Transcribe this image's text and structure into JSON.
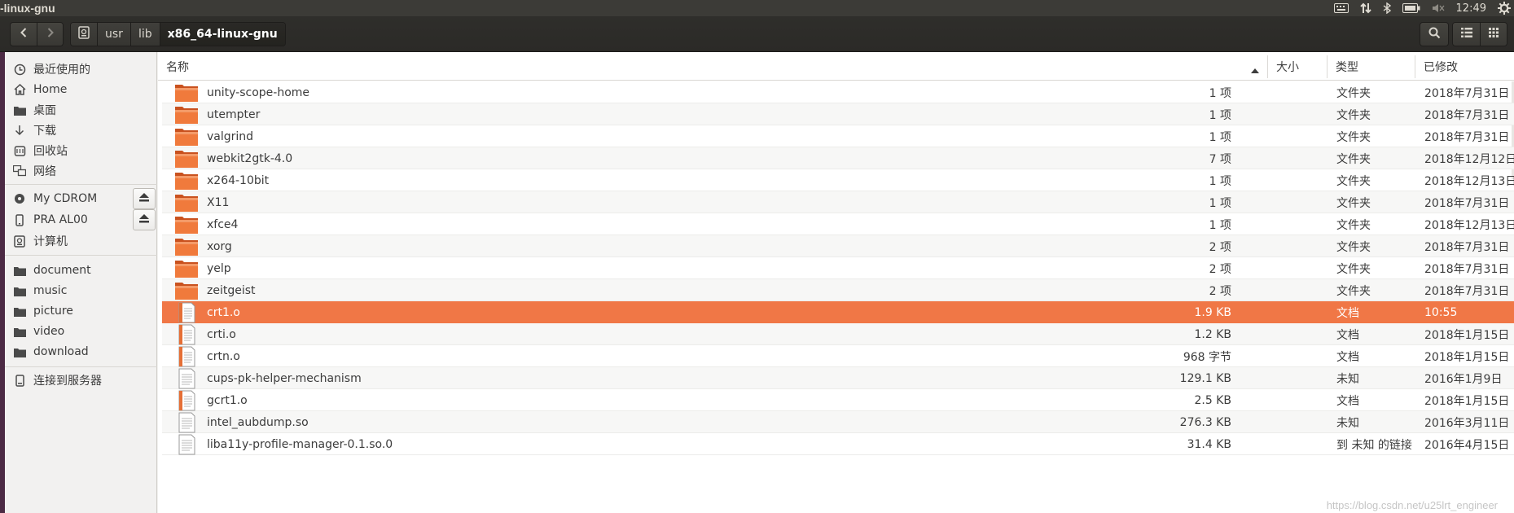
{
  "window": {
    "title": "-linux-gnu"
  },
  "tray": {
    "time": "12:49"
  },
  "header": {
    "back_icon": "chevron-left-icon",
    "forward_icon": "chevron-right-icon",
    "breadcrumbs": [
      {
        "label": "usr"
      },
      {
        "label": "lib"
      },
      {
        "label": "x86_64-linux-gnu"
      }
    ],
    "search_icon": "search-icon",
    "list_view_icon": "list-view-icon",
    "grid_view_icon": "grid-view-icon"
  },
  "sidebar": {
    "items": [
      {
        "label": "最近使用的",
        "icon": "clock-icon"
      },
      {
        "label": "Home",
        "icon": "home-icon"
      },
      {
        "label": "桌面",
        "icon": "folder-icon"
      },
      {
        "label": "下载",
        "icon": "download-arrow-icon"
      },
      {
        "label": "回收站",
        "icon": "trash-icon"
      },
      {
        "label": "网络",
        "icon": "network-icon"
      },
      {
        "label": "My CDROM",
        "icon": "disc-icon"
      },
      {
        "label": "PRA AL00",
        "icon": "phone-icon"
      },
      {
        "label": "计算机",
        "icon": "computer-icon"
      },
      {
        "label": "document",
        "icon": "folder-icon"
      },
      {
        "label": "music",
        "icon": "folder-icon"
      },
      {
        "label": "picture",
        "icon": "folder-icon"
      },
      {
        "label": "video",
        "icon": "folder-icon"
      },
      {
        "label": "download",
        "icon": "folder-icon"
      },
      {
        "label": "连接到服务器",
        "icon": "server-icon"
      }
    ]
  },
  "columns": {
    "name": "名称",
    "size": "大小",
    "type": "类型",
    "modified": "已修改"
  },
  "files": [
    {
      "name": "unity-scope-home",
      "size": "1 项",
      "type": "文件夹",
      "modified": "2018年7月31日",
      "kind": "folder"
    },
    {
      "name": "utempter",
      "size": "1 项",
      "type": "文件夹",
      "modified": "2018年7月31日",
      "kind": "folder"
    },
    {
      "name": "valgrind",
      "size": "1 项",
      "type": "文件夹",
      "modified": "2018年7月31日",
      "kind": "folder"
    },
    {
      "name": "webkit2gtk-4.0",
      "size": "7 项",
      "type": "文件夹",
      "modified": "2018年12月12日",
      "kind": "folder"
    },
    {
      "name": "x264-10bit",
      "size": "1 项",
      "type": "文件夹",
      "modified": "2018年12月13日",
      "kind": "folder"
    },
    {
      "name": "X11",
      "size": "1 项",
      "type": "文件夹",
      "modified": "2018年7月31日",
      "kind": "folder"
    },
    {
      "name": "xfce4",
      "size": "1 项",
      "type": "文件夹",
      "modified": "2018年12月13日",
      "kind": "folder"
    },
    {
      "name": "xorg",
      "size": "2 项",
      "type": "文件夹",
      "modified": "2018年7月31日",
      "kind": "folder"
    },
    {
      "name": "yelp",
      "size": "2 项",
      "type": "文件夹",
      "modified": "2018年7月31日",
      "kind": "folder"
    },
    {
      "name": "zeitgeist",
      "size": "2 项",
      "type": "文件夹",
      "modified": "2018年7月31日",
      "kind": "folder"
    },
    {
      "name": "crt1.o",
      "size": "1.9 KB",
      "type": "文档",
      "modified": "10:55",
      "kind": "doc",
      "selected": true
    },
    {
      "name": "crti.o",
      "size": "1.2 KB",
      "type": "文档",
      "modified": "2018年1月15日",
      "kind": "doc"
    },
    {
      "name": "crtn.o",
      "size": "968 字节",
      "type": "文档",
      "modified": "2018年1月15日",
      "kind": "doc"
    },
    {
      "name": "cups-pk-helper-mechanism",
      "size": "129.1 KB",
      "type": "未知",
      "modified": "2016年1月9日",
      "kind": "plain"
    },
    {
      "name": "gcrt1.o",
      "size": "2.5 KB",
      "type": "文档",
      "modified": "2018年1月15日",
      "kind": "doc"
    },
    {
      "name": "intel_aubdump.so",
      "size": "276.3 KB",
      "type": "未知",
      "modified": "2016年3月11日",
      "kind": "plain"
    },
    {
      "name": "liba11y-profile-manager-0.1.so.0",
      "size": "31.4 KB",
      "type": "到 未知 的链接",
      "modified": "2016年4月15日",
      "kind": "plain"
    }
  ],
  "watermark": "https://blog.csdn.net/u25lrt_engineer",
  "colors": {
    "accent": "#f07746",
    "folder": "#e9662a",
    "headerbar": "#2f2e2b",
    "dock": "#4c2a44"
  }
}
